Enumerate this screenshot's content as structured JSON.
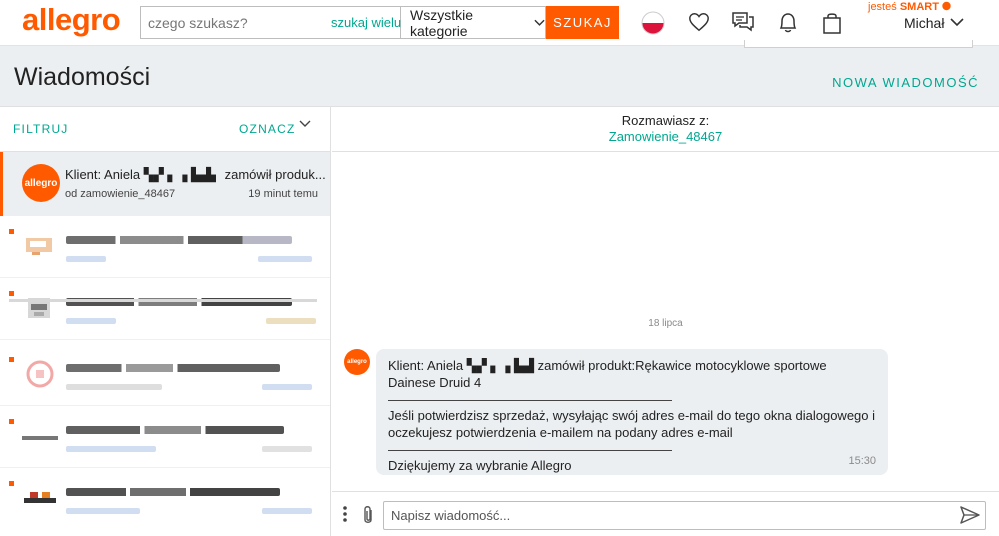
{
  "header": {
    "logo": "allegro",
    "search_placeholder": "czego szukasz?",
    "search_many": "szukaj wielu",
    "category": "Wszystkie kategorie",
    "search_button": "SZUKAJ",
    "smart_prefix": "jesteś",
    "smart_label": "SMART",
    "user_name": "Michał"
  },
  "page": {
    "title": "Wiadomości",
    "new_message": "NOWA WIADOMOŚĆ"
  },
  "sidebar": {
    "filter": "FILTRUJ",
    "mark": "OZNACZ",
    "active": {
      "avatar": "allegro",
      "title": "Klient: Aniela ▚▞ ▖▗ ▙▟▖ zamówił produk...",
      "subtitle": "od zamowienie_48467",
      "time": "19 minut temu"
    }
  },
  "chat": {
    "with_label": "Rozmawiasz z:",
    "with_name": "Zamowienie_48467",
    "date": "18 lipca",
    "avatar": "allegro",
    "lines": {
      "line1": "Klient: Aniela ▚▞ ▖▗ ▙▟ zamówił produkt:Rękawice motocyklowe sportowe Dainese Druid 4",
      "line2": "Jeśli potwierdzisz sprzedaż, wysyłając swój adres e-mail do tego okna dialogowego i",
      "line3": "oczekujesz potwierdzenia e-mailem na podany adres e-mail",
      "line4": "Dziękujemy za wybranie Allegro"
    },
    "time": "15:30",
    "composer_placeholder": "Napisz wiadomość..."
  },
  "colors": {
    "accent": "#ff5a00",
    "link": "#00a790"
  }
}
